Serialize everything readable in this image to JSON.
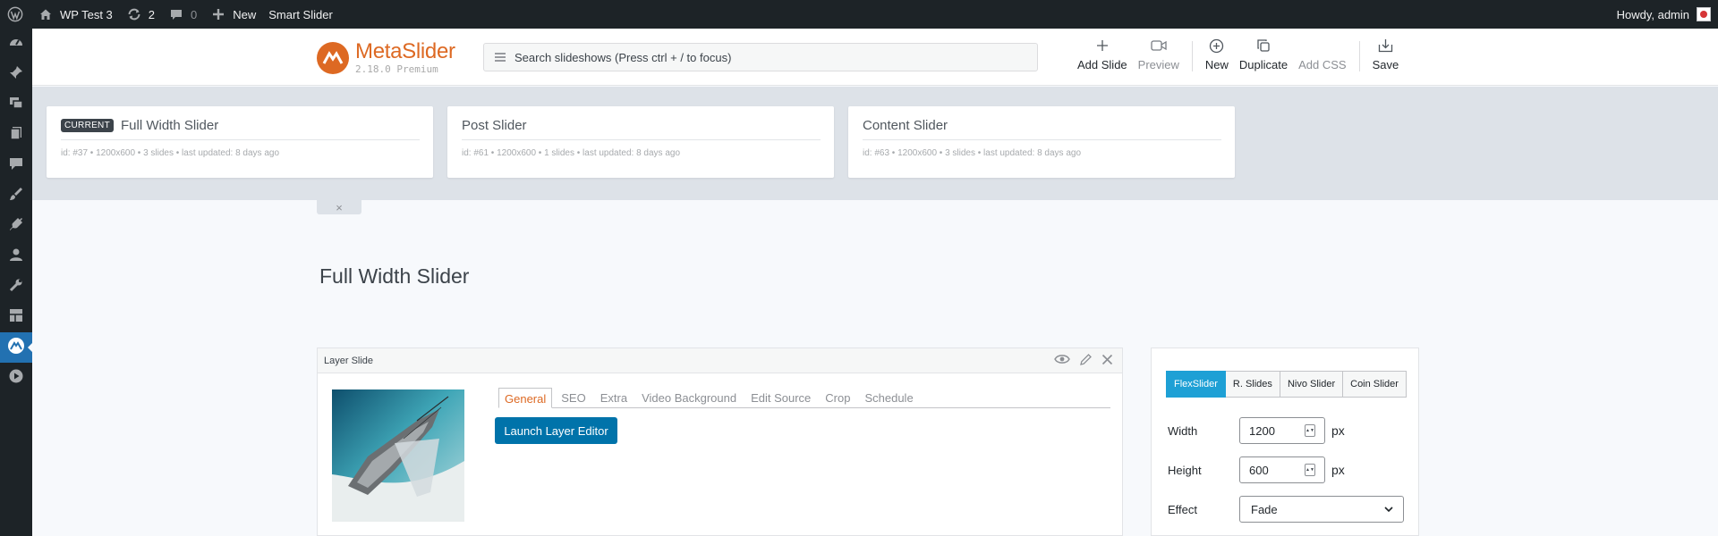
{
  "adminbar": {
    "site_name": "WP Test 3",
    "updates_count": "2",
    "comments_count": "0",
    "new_label": "New",
    "plugin_link": "Smart Slider",
    "greeting": "Howdy, admin"
  },
  "header": {
    "logo_part1": "Meta",
    "logo_part2": "Slider",
    "version": "2.18.0",
    "edition": "Premium",
    "search_placeholder": "Search slideshows (Press ctrl + / to focus)",
    "tools": {
      "add_slide": "Add Slide",
      "preview": "Preview",
      "new": "New",
      "duplicate": "Duplicate",
      "add_css": "Add CSS",
      "save": "Save"
    }
  },
  "slideshows": [
    {
      "badge": "CURRENT",
      "title": "Full Width Slider",
      "meta": "id: #37 • 1200x600 • 3 slides • last updated: 8 days ago"
    },
    {
      "title": "Post Slider",
      "meta": "id: #61 • 1200x600 • 1 slides • last updated: 8 days ago"
    },
    {
      "title": "Content Slider",
      "meta": "id: #63 • 1200x600 • 3 slides • last updated: 8 days ago"
    }
  ],
  "strip_close": "×",
  "page_title": "Full Width Slider",
  "slide": {
    "header_label": "Layer Slide",
    "tabs": [
      "General",
      "SEO",
      "Extra",
      "Video Background",
      "Edit Source",
      "Crop",
      "Schedule"
    ],
    "launch_button": "Launch Layer Editor"
  },
  "settings": {
    "slider_types": [
      "FlexSlider",
      "R. Slides",
      "Nivo Slider",
      "Coin Slider"
    ],
    "width_label": "Width",
    "width_value": "1200",
    "height_label": "Height",
    "height_value": "600",
    "unit": "px",
    "effect_label": "Effect",
    "effect_value": "Fade"
  },
  "colors": {
    "accent_orange": "#dd6923",
    "button_blue": "#0073aa",
    "active_type_blue": "#1ea0d5",
    "admin_dark": "#1d2327"
  }
}
